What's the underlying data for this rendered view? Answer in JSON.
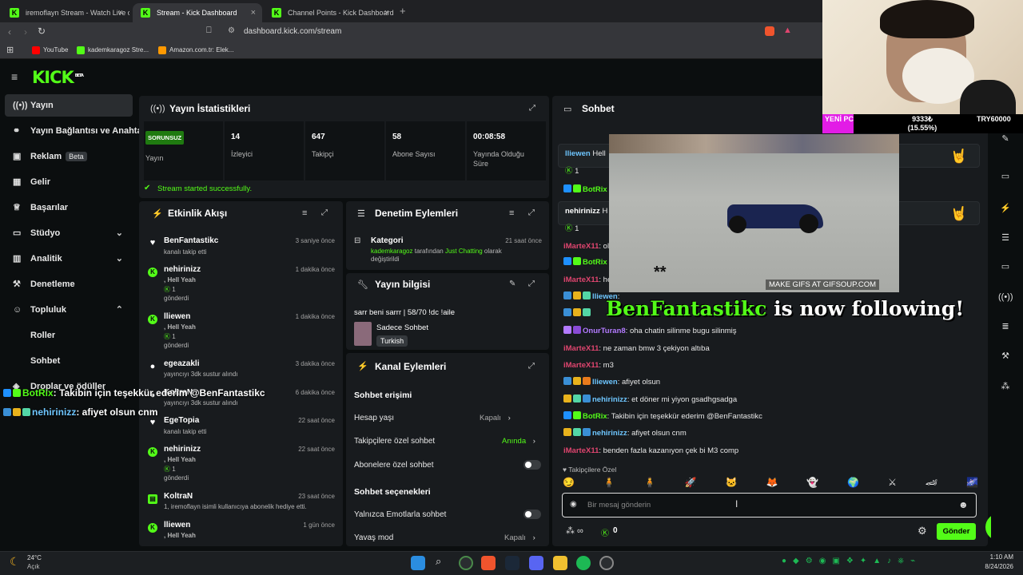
{
  "browser": {
    "tabs": [
      {
        "title": "iremoflayn Stream - Watch Live o",
        "active": false
      },
      {
        "title": "Stream - Kick Dashboard",
        "active": true
      },
      {
        "title": "Channel Points - Kick Dashboard",
        "active": false
      }
    ],
    "url": "dashboard.kick.com/stream",
    "bookmarks": [
      "YouTube",
      "kademkaragoz Stre...",
      "Amazon.com.tr: Elek..."
    ]
  },
  "kick": {
    "logo": "KICK",
    "logo_badge": "BETA"
  },
  "sidebar": {
    "items": [
      {
        "label": "Yayın",
        "icon": "broadcast-icon",
        "active": true
      },
      {
        "label": "Yayın Bağlantısı ve Anahtar",
        "icon": "link-icon"
      },
      {
        "label": "Reklam",
        "icon": "ad-icon",
        "badge": "Beta"
      },
      {
        "label": "Gelir",
        "icon": "money-icon"
      },
      {
        "label": "Başarılar",
        "icon": "trophy-icon"
      },
      {
        "label": "Stüdyo",
        "icon": "studio-icon",
        "expandable": true
      },
      {
        "label": "Analitik",
        "icon": "chart-icon",
        "expandable": true
      },
      {
        "label": "Denetleme",
        "icon": "hammer-icon"
      },
      {
        "label": "Topluluk",
        "icon": "community-icon",
        "expanded": true
      },
      {
        "label": "Roller",
        "sub": true
      },
      {
        "label": "Sohbet",
        "sub": true
      },
      {
        "label": "Droplar ve ödüller",
        "icon": "gift-icon"
      }
    ]
  },
  "stats": {
    "title": "Yayın İstatistikleri",
    "status_badge": "SORUNSUZ",
    "status_label": "Yayın",
    "items": [
      {
        "value": "14",
        "label": "İzleyici"
      },
      {
        "value": "647",
        "label": "Takipçi"
      },
      {
        "value": "58",
        "label": "Abone Sayısı"
      },
      {
        "value": "00:08:58",
        "label": "Yayında Olduğu Süre"
      }
    ],
    "success_msg": "Stream started successfully."
  },
  "activity": {
    "title": "Etkinlik Akışı",
    "items": [
      {
        "name": "BenFantastikc",
        "time": "3 saniye önce",
        "lines": [
          "kanalı takip etti"
        ],
        "icon": "heart-icon"
      },
      {
        "name": "nehirinizz",
        "time": "1 dakika önce",
        "lines": [
          ", Hell Yeah",
          "1",
          "gönderdi"
        ],
        "icon": "kick-coin-icon"
      },
      {
        "name": "lliewen",
        "time": "1 dakika önce",
        "lines": [
          ", Hell Yeah",
          "1",
          "gönderdi"
        ],
        "icon": "kick-coin-icon"
      },
      {
        "name": "egeazakli",
        "time": "3 dakika önce",
        "lines": [
          "yayıncıyı 3dk sustur alındı"
        ],
        "icon": "reward-icon"
      },
      {
        "name": "KoltraN",
        "time": "6 dakika önce",
        "lines": [
          "yayıncıyı 3dk sustur alındı"
        ],
        "icon": "reward-icon"
      },
      {
        "name": "EgeTopia",
        "time": "22 saat önce",
        "lines": [
          "kanalı takip etti"
        ],
        "icon": "heart-icon"
      },
      {
        "name": "nehirinizz",
        "time": "22 saat önce",
        "lines": [
          ", Hell Yeah",
          "1",
          "gönderdi"
        ],
        "icon": "kick-coin-icon"
      },
      {
        "name": "KoltraN",
        "time": "23 saat önce",
        "lines": [
          "1, iremoflayn isimli kullanıcıya abonelik hediye etti."
        ],
        "icon": "gift-sub-icon"
      },
      {
        "name": "lliewen",
        "time": "1 gün önce",
        "lines": [
          ", Hell Yeah"
        ],
        "icon": "kick-coin-icon"
      }
    ]
  },
  "moderation": {
    "title": "Denetim Eylemleri",
    "item_title": "Kategori",
    "item_time": "21 saat önce",
    "item_user": "kademkaragoz",
    "item_mid": "tarafından",
    "item_value": "Just Chatting",
    "item_tail": "olarak değiştirildi"
  },
  "stream_info": {
    "title": "Yayın bilgisi",
    "stream_title": "sarr beni sarrr | 58/70 !dc !aile",
    "category": "Sadece Sohbet",
    "language": "Turkish"
  },
  "channel_actions": {
    "title": "Kanal Eylemleri",
    "section1": "Sohbet erişimi",
    "rows1": [
      {
        "label": "Hesap yaşı",
        "value": "Kapalı",
        "type": "select"
      },
      {
        "label": "Takipçilere özel sohbet",
        "value": "Anında",
        "type": "select"
      },
      {
        "label": "Abonelere özel sohbet",
        "type": "toggle"
      }
    ],
    "section2": "Sohbet seçenekleri",
    "rows2": [
      {
        "label": "Yalnızca Emotlarla sohbet",
        "type": "toggle"
      },
      {
        "label": "Yavaş mod",
        "value": "Kapalı",
        "type": "select"
      }
    ]
  },
  "chat": {
    "title": "Sohbet",
    "pinned": [
      {
        "user": "lliewen",
        "text": "Hell",
        "count": "1"
      },
      {
        "user": "nehirinizz",
        "text": "H",
        "count": "1"
      }
    ],
    "pinned_bot_user": "BotRix",
    "messages": [
      {
        "user": "iMarteX11",
        "text": "ol",
        "color": "red"
      },
      {
        "user": "BotRix",
        "text": "",
        "color": "green"
      },
      {
        "user": "iMarteX11",
        "text": "he",
        "color": "red"
      },
      {
        "user": "lliewen",
        "text": "",
        "color": "cyan"
      },
      {
        "user": "",
        "text": "",
        "color": "red"
      },
      {
        "user": "OnurTuran8",
        "text": "oha chatin silinme bugu silinmiş",
        "color": "purple"
      },
      {
        "user": "iMarteX11",
        "text": "ne zaman bmw 3 çekiyon altıba",
        "color": "red"
      },
      {
        "user": "iMarteX11",
        "text": "m3",
        "color": "red"
      },
      {
        "user": "lliewen",
        "text": "afiyet olsun",
        "color": "cyan"
      },
      {
        "user": "nehirinizz",
        "text": "et döner mi yiyon gsadhgsadga",
        "color": "cyan"
      },
      {
        "user": "BotRix",
        "text": "Takibin için teşekkür ederim @BenFantastikc",
        "color": "green"
      },
      {
        "user": "nehirinizz",
        "text": "afiyet olsun cnm",
        "color": "cyan"
      },
      {
        "user": "iMarteX11",
        "text": "benden fazla kazanıyon çek bi M3 comp",
        "color": "red"
      }
    ],
    "followers_only": "Takipçilere Özel",
    "input_placeholder": "Bir mesaj gönderin",
    "points": "0",
    "send_label": "Gönder"
  },
  "overlay": {
    "gif_caption": "MAKE GIFS AT GIFSOUP.COM",
    "gif_text": "**",
    "follow_name": "BenFantastikc",
    "follow_text": " is now following!",
    "bot_line_user": "BotRix",
    "bot_line_text": ": Takibin için teşekkür ederim @BenFantastikc",
    "chat_line_user": "nehirinizz",
    "chat_line_text": ": afiyet olsun cnm",
    "cam_label": "YENİ PC",
    "cam_value": "9333₺",
    "cam_percent": "(15.55%)",
    "cam_goal": "TRY60000",
    "cam_progress_fraction": 0.1555
  },
  "taskbar": {
    "weather_temp": "24°C",
    "weather_desc": "Açık",
    "time": "1:10 AM",
    "date": "8/24/2026"
  },
  "colors": {
    "accent": "#53fc18",
    "bg": "#0b0e0f",
    "panel": "#181b1e"
  }
}
